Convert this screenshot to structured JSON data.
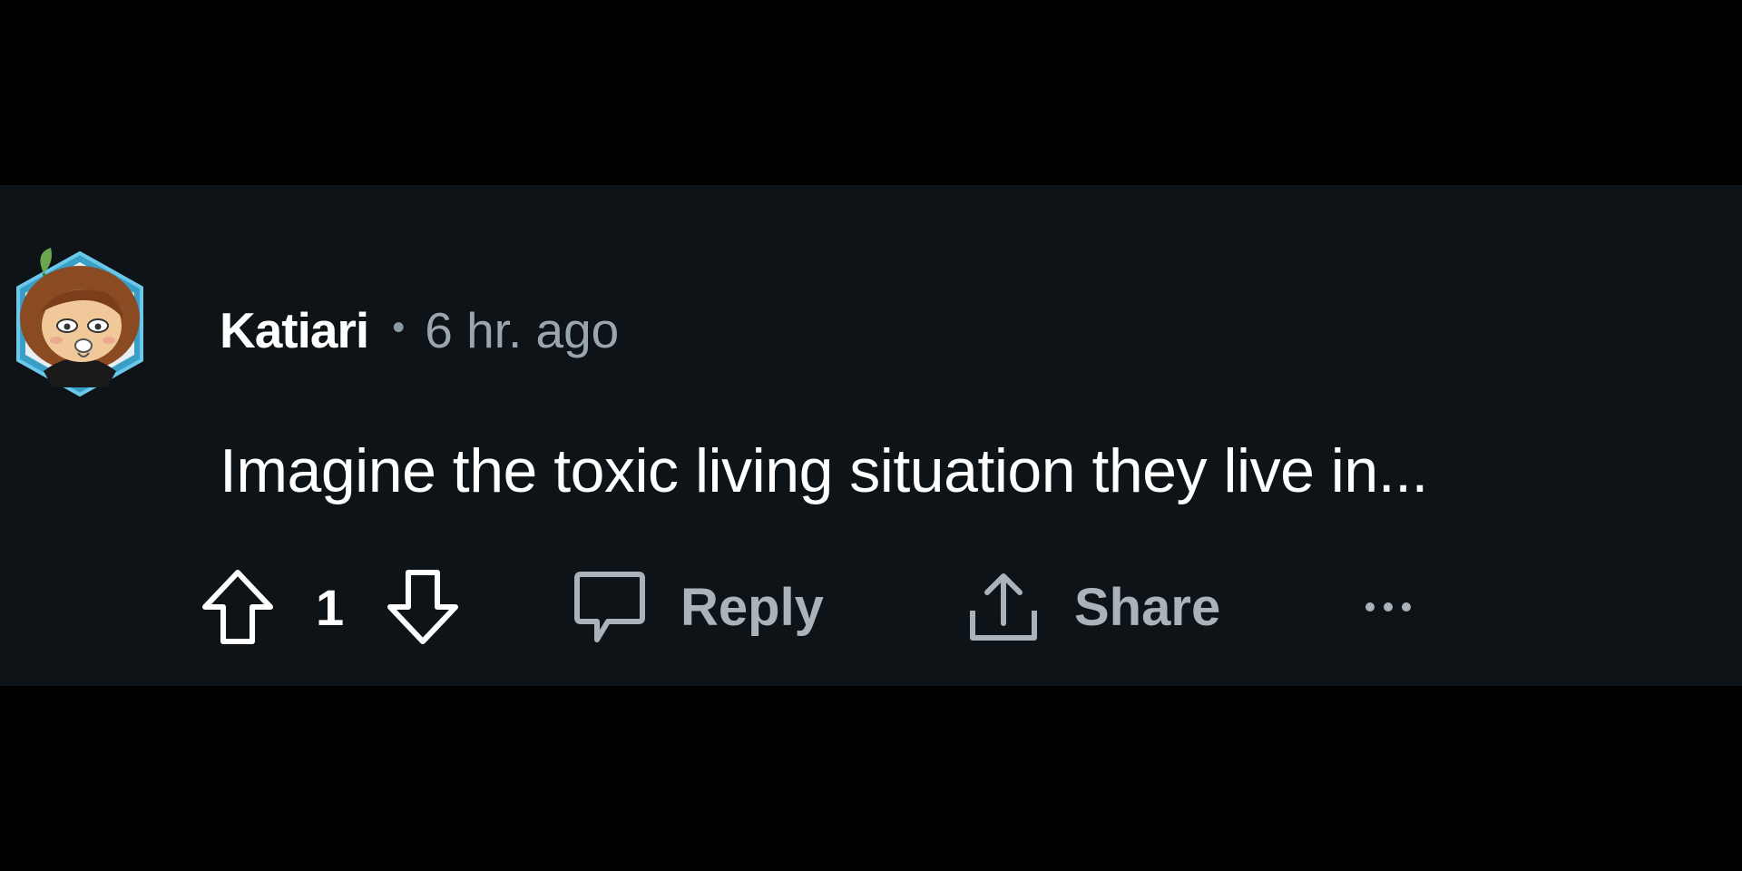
{
  "comment": {
    "username": "Katiari",
    "separator": "•",
    "timestamp": "6 hr. ago",
    "body": "Imagine the toxic living situation they live in...",
    "avatar_icon": "user-avatar-icon"
  },
  "actions": {
    "upvote_icon": "upvote-arrow-icon",
    "vote_count": "1",
    "downvote_icon": "downvote-arrow-icon",
    "reply_icon": "speech-bubble-icon",
    "reply_label": "Reply",
    "share_icon": "share-icon",
    "share_label": "Share",
    "more_icon": "more-options-icon"
  },
  "colors": {
    "page_background": "#000000",
    "panel_background": "#0d1317",
    "primary_text": "#ffffff",
    "secondary_text": "#9aa6ad",
    "avatar_accent": "#4fb3d9"
  }
}
